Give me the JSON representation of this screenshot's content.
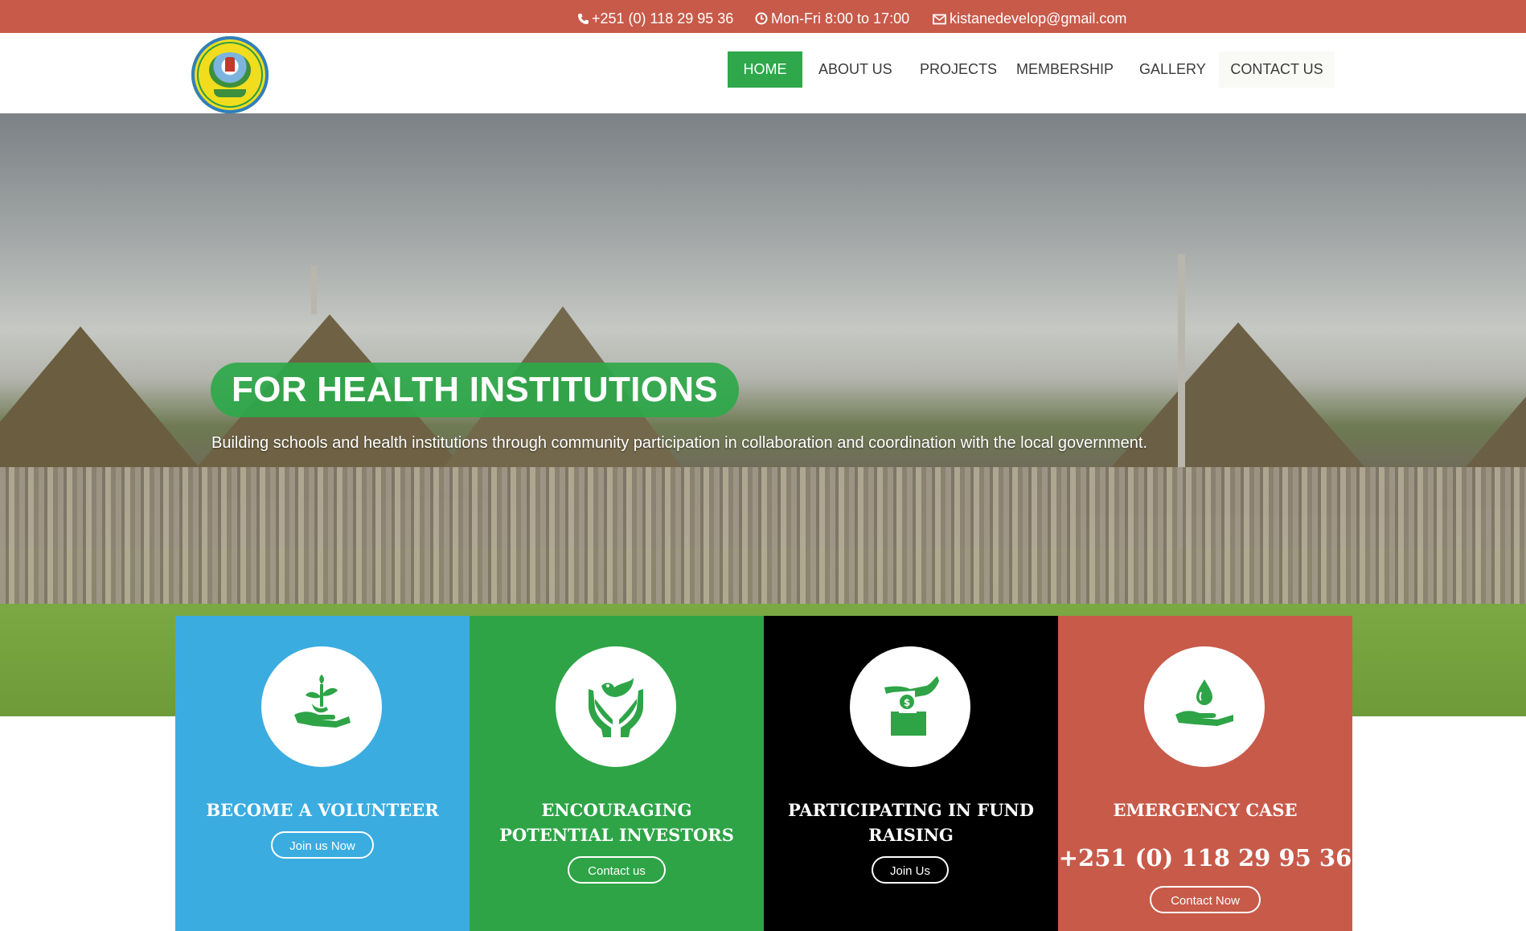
{
  "topbar": {
    "phone": "+251 (0) 118 29 95 36",
    "hours": "Mon-Fri 8:00 to 17:00",
    "email": "kistanedevelop@gmail.com",
    "background_color": "#c85a4a"
  },
  "nav": {
    "items": [
      {
        "label": "HOME",
        "active": true
      },
      {
        "label": "ABOUT US",
        "active": false
      },
      {
        "label": "PROJECTS",
        "active": false
      },
      {
        "label": "MEMBERSHIP",
        "active": false
      },
      {
        "label": "GALLERY",
        "active": false
      },
      {
        "label": "CONTACT US",
        "active": false
      }
    ],
    "active_color": "#2ea84a"
  },
  "hero": {
    "title": "FOR HEALTH INSTITUTIONS",
    "subtitle": "Building schools and health institutions through community participation in collaboration and coordination with the local government."
  },
  "boxes": [
    {
      "title": "BECOME A VOLUNTEER",
      "button": "Join us Now",
      "color": "#3aace0",
      "icon": "hand-plant-icon"
    },
    {
      "title": "ENCOURAGING POTENTIAL INVESTORS",
      "button": "Contact us",
      "color": "#2ea447",
      "icon": "hands-dove-icon"
    },
    {
      "title": "PARTICIPATING IN FUND RAISING",
      "button": "Join Us",
      "color": "#000000",
      "icon": "donation-box-icon"
    },
    {
      "title": "EMERGENCY CASE",
      "phone": "+251 (0) 118 29 95 36",
      "button": "Contact Now",
      "color": "#c85a4a",
      "icon": "hand-water-drop-icon"
    }
  ]
}
